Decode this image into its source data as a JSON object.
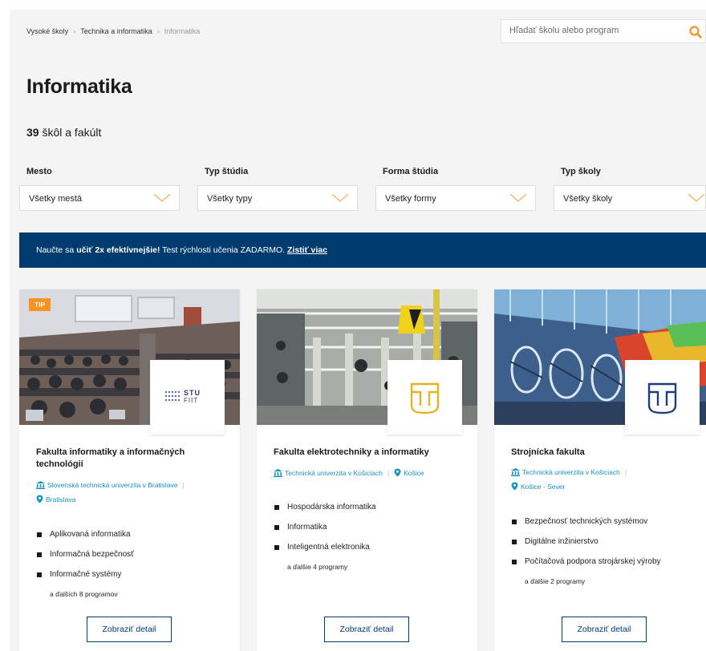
{
  "breadcrumb": {
    "items": [
      "Vysoké školy",
      "Technika a informatika"
    ],
    "current": "Informatika"
  },
  "search": {
    "placeholder": "Hľadať školu alebo program",
    "icon": "search-icon"
  },
  "page": {
    "title": "Informatika",
    "count": "39",
    "count_suffix": " škôl a fakúlt"
  },
  "filters": [
    {
      "label": "Mesto",
      "value": "Všetky mestá"
    },
    {
      "label": "Typ štúdia",
      "value": "Všetky typy"
    },
    {
      "label": "Forma štúdia",
      "value": "Všetky formy"
    },
    {
      "label": "Typ školy",
      "value": "Všetky školy"
    }
  ],
  "banner": {
    "pre": "Naučte sa ",
    "bold": "učiť 2x efektívnejšie!",
    "post": " Test rýchlosti učenia ZADARMO. ",
    "link": "Zistiť viac"
  },
  "cards": [
    {
      "badge": "TIP",
      "logo_text": [
        "STU",
        "FIIT"
      ],
      "title": "Fakulta informatiky a informačných technológií",
      "university": "Slovenská technická univerzita v Bratislave",
      "city": "Bratislava",
      "programs": [
        "Aplikovaná informatika",
        "Informačná bezpečnosť",
        "Informačné systémy"
      ],
      "more": "a ďalších 8 programov",
      "button": "Zobraziť detail"
    },
    {
      "title": "Fakulta elektrotechniky a informatiky",
      "university": "Technická univerzita v Košiciach",
      "city": "Košice",
      "programs": [
        "Hospodárska informatika",
        "Informatika",
        "Inteligentná elektronika"
      ],
      "more": "a ďalšie 4 programy",
      "button": "Zobraziť detail"
    },
    {
      "title": "Strojnícka fakulta",
      "university": "Technická univerzita v Košiciach",
      "city": "Košice - Sever",
      "programs": [
        "Bezpečnosť technických systémov",
        "Digitálne inžinierstvo",
        "Počítačová podpora strojárskej výroby"
      ],
      "more": "a ďalšie 2 programy",
      "button": "Zobraziť detail"
    }
  ],
  "colors": {
    "brand": "#003b6f",
    "accent": "#f7931e",
    "link": "#1593c2",
    "tuke_gold": "#e8b11f"
  }
}
